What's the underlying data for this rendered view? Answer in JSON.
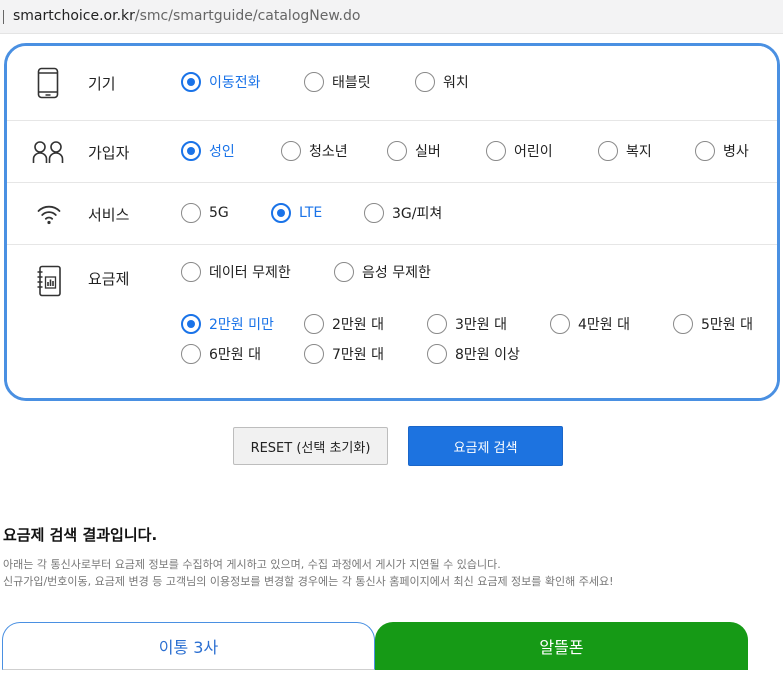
{
  "url": {
    "host": "smartchoice.or.kr",
    "path": "/smc/smartguide/catalogNew.do"
  },
  "filters": {
    "device": {
      "label": "기기",
      "icon": "smartphone-icon",
      "options": [
        "이동전화",
        "태블릿",
        "워치"
      ],
      "selected": "이동전화"
    },
    "subscriber": {
      "label": "가입자",
      "icon": "users-icon",
      "options": [
        "성인",
        "청소년",
        "실버",
        "어린이",
        "복지",
        "병사"
      ],
      "selected": "성인"
    },
    "service": {
      "label": "서비스",
      "icon": "wifi-icon",
      "options": [
        "5G",
        "LTE",
        "3G/피쳐"
      ],
      "selected": "LTE"
    },
    "plan": {
      "label": "요금제",
      "icon": "price-chart-book-icon",
      "type_options": [
        "데이터 무제한",
        "음성 무제한"
      ],
      "price_options": [
        "2만원 미만",
        "2만원 대",
        "3만원 대",
        "4만원 대",
        "5만원 대",
        "6만원 대",
        "7만원 대",
        "8만원 이상"
      ],
      "selected_price": "2만원 미만"
    }
  },
  "buttons": {
    "reset": "RESET (선택 초기화)",
    "search": "요금제 검색"
  },
  "results": {
    "title": "요금제 검색 결과입니다.",
    "notice_1": "아래는 각 통신사로부터 요금제 정보를 수집하여 게시하고 있으며, 수집 과정에서 게시가 지연될 수 있습니다.",
    "notice_2": "신규가입/번호이동, 요금제 변경 등 고객님의 이용정보를 변경할 경우에는 각 통신사 홈페이지에서 최신 요금제 정보를 확인해 주세요!"
  },
  "tabs": [
    "이통 3사",
    "알뜰폰"
  ],
  "colors": {
    "accent": "#1a73e8",
    "panel_border": "#4a90e2",
    "mvno_tab": "#169a16"
  }
}
